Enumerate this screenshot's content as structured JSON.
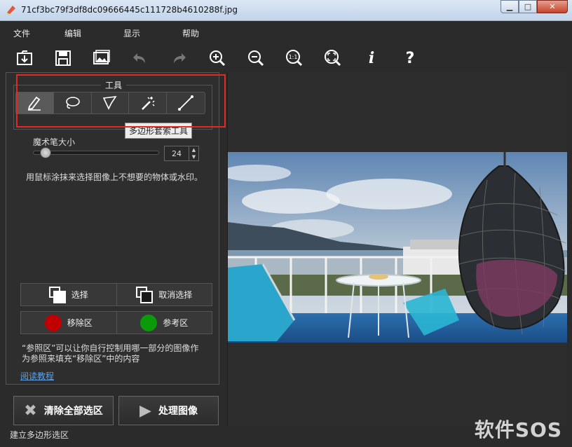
{
  "window": {
    "title": "71cf3bc79f3df8dc09666445c111728b4610288f.jpg",
    "controls": {
      "minimize": "▁",
      "maximize": "□",
      "close": "✕"
    }
  },
  "menu": [
    "文件",
    "编辑",
    "显示",
    "帮助"
  ],
  "toolbar": {
    "icons": [
      "open-icon",
      "save-icon",
      "image-icon",
      "undo-icon",
      "redo-icon",
      "zoom-in-icon",
      "zoom-out-icon",
      "zoom-1to1-icon",
      "zoom-fit-icon",
      "info-icon",
      "help-icon"
    ],
    "zoom_1to1_text": "1:1",
    "info_text": "i",
    "help_text": "?"
  },
  "tools": {
    "group_title": "工具",
    "items": [
      "marker-icon",
      "lasso-icon",
      "polygon-lasso-icon",
      "magic-wand-icon",
      "line-icon"
    ],
    "active_index": 0,
    "tooltip": "多边形套索工具"
  },
  "brush": {
    "label": "魔术笔大小",
    "value": "24",
    "slider_fraction": 0.06
  },
  "hint": "用鼠标涂抹来选择图像上不想要的物体或水印。",
  "selection": {
    "select_label": "选择",
    "deselect_label": "取消选择"
  },
  "zones": {
    "remove_label": "移除区",
    "reference_label": "参考区",
    "remove_color": "#c00000",
    "reference_color": "#0a9a0a"
  },
  "reference_note_1": "“参照区”可以让你自行控制用哪一部分的图像作",
  "reference_note_2": "为参照来填充“移除区”中的内容",
  "tutorial_link": "阅读教程",
  "actions": {
    "clear_label": "清除全部选区",
    "process_label": "处理图像"
  },
  "status": "建立多边形选区",
  "watermark": "软件SOS",
  "colors": {
    "highlight": "#e12a24",
    "link": "#5fa2e6",
    "background": "#2b2b2b"
  }
}
